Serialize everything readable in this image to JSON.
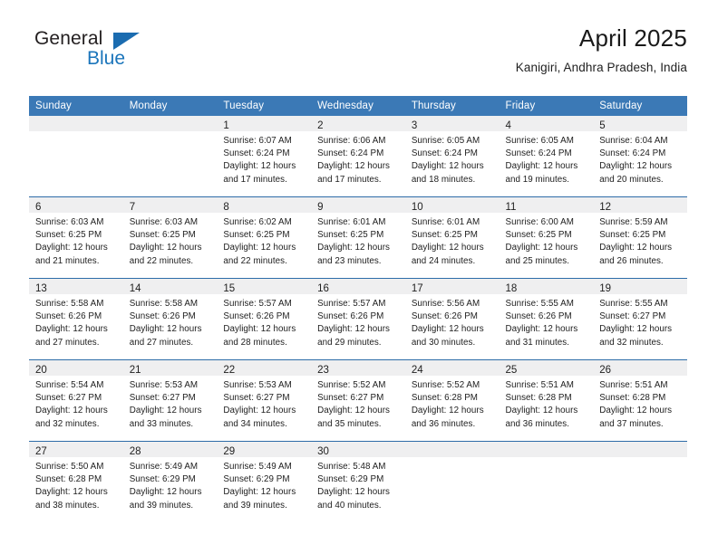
{
  "brand": {
    "name_top": "General",
    "name_bottom": "Blue",
    "color_dark": "#231f20",
    "color_blue": "#1b75bb",
    "triangle_icon": "triangle-icon"
  },
  "header": {
    "title": "April 2025",
    "subtitle": "Kanigiri, Andhra Pradesh, India"
  },
  "theme": {
    "header_blue": "#3b79b6",
    "row_divider": "#2d6ca8",
    "daynum_band": "#efeff0",
    "text": "#1d1d1d"
  },
  "calendar": {
    "weekday_headers": [
      "Sunday",
      "Monday",
      "Tuesday",
      "Wednesday",
      "Thursday",
      "Friday",
      "Saturday"
    ],
    "weeks": [
      [
        {
          "day": "",
          "lines": []
        },
        {
          "day": "",
          "lines": []
        },
        {
          "day": "1",
          "lines": [
            "Sunrise: 6:07 AM",
            "Sunset: 6:24 PM",
            "Daylight: 12 hours",
            "and 17 minutes."
          ]
        },
        {
          "day": "2",
          "lines": [
            "Sunrise: 6:06 AM",
            "Sunset: 6:24 PM",
            "Daylight: 12 hours",
            "and 17 minutes."
          ]
        },
        {
          "day": "3",
          "lines": [
            "Sunrise: 6:05 AM",
            "Sunset: 6:24 PM",
            "Daylight: 12 hours",
            "and 18 minutes."
          ]
        },
        {
          "day": "4",
          "lines": [
            "Sunrise: 6:05 AM",
            "Sunset: 6:24 PM",
            "Daylight: 12 hours",
            "and 19 minutes."
          ]
        },
        {
          "day": "5",
          "lines": [
            "Sunrise: 6:04 AM",
            "Sunset: 6:24 PM",
            "Daylight: 12 hours",
            "and 20 minutes."
          ]
        }
      ],
      [
        {
          "day": "6",
          "lines": [
            "Sunrise: 6:03 AM",
            "Sunset: 6:25 PM",
            "Daylight: 12 hours",
            "and 21 minutes."
          ]
        },
        {
          "day": "7",
          "lines": [
            "Sunrise: 6:03 AM",
            "Sunset: 6:25 PM",
            "Daylight: 12 hours",
            "and 22 minutes."
          ]
        },
        {
          "day": "8",
          "lines": [
            "Sunrise: 6:02 AM",
            "Sunset: 6:25 PM",
            "Daylight: 12 hours",
            "and 22 minutes."
          ]
        },
        {
          "day": "9",
          "lines": [
            "Sunrise: 6:01 AM",
            "Sunset: 6:25 PM",
            "Daylight: 12 hours",
            "and 23 minutes."
          ]
        },
        {
          "day": "10",
          "lines": [
            "Sunrise: 6:01 AM",
            "Sunset: 6:25 PM",
            "Daylight: 12 hours",
            "and 24 minutes."
          ]
        },
        {
          "day": "11",
          "lines": [
            "Sunrise: 6:00 AM",
            "Sunset: 6:25 PM",
            "Daylight: 12 hours",
            "and 25 minutes."
          ]
        },
        {
          "day": "12",
          "lines": [
            "Sunrise: 5:59 AM",
            "Sunset: 6:25 PM",
            "Daylight: 12 hours",
            "and 26 minutes."
          ]
        }
      ],
      [
        {
          "day": "13",
          "lines": [
            "Sunrise: 5:58 AM",
            "Sunset: 6:26 PM",
            "Daylight: 12 hours",
            "and 27 minutes."
          ]
        },
        {
          "day": "14",
          "lines": [
            "Sunrise: 5:58 AM",
            "Sunset: 6:26 PM",
            "Daylight: 12 hours",
            "and 27 minutes."
          ]
        },
        {
          "day": "15",
          "lines": [
            "Sunrise: 5:57 AM",
            "Sunset: 6:26 PM",
            "Daylight: 12 hours",
            "and 28 minutes."
          ]
        },
        {
          "day": "16",
          "lines": [
            "Sunrise: 5:57 AM",
            "Sunset: 6:26 PM",
            "Daylight: 12 hours",
            "and 29 minutes."
          ]
        },
        {
          "day": "17",
          "lines": [
            "Sunrise: 5:56 AM",
            "Sunset: 6:26 PM",
            "Daylight: 12 hours",
            "and 30 minutes."
          ]
        },
        {
          "day": "18",
          "lines": [
            "Sunrise: 5:55 AM",
            "Sunset: 6:26 PM",
            "Daylight: 12 hours",
            "and 31 minutes."
          ]
        },
        {
          "day": "19",
          "lines": [
            "Sunrise: 5:55 AM",
            "Sunset: 6:27 PM",
            "Daylight: 12 hours",
            "and 32 minutes."
          ]
        }
      ],
      [
        {
          "day": "20",
          "lines": [
            "Sunrise: 5:54 AM",
            "Sunset: 6:27 PM",
            "Daylight: 12 hours",
            "and 32 minutes."
          ]
        },
        {
          "day": "21",
          "lines": [
            "Sunrise: 5:53 AM",
            "Sunset: 6:27 PM",
            "Daylight: 12 hours",
            "and 33 minutes."
          ]
        },
        {
          "day": "22",
          "lines": [
            "Sunrise: 5:53 AM",
            "Sunset: 6:27 PM",
            "Daylight: 12 hours",
            "and 34 minutes."
          ]
        },
        {
          "day": "23",
          "lines": [
            "Sunrise: 5:52 AM",
            "Sunset: 6:27 PM",
            "Daylight: 12 hours",
            "and 35 minutes."
          ]
        },
        {
          "day": "24",
          "lines": [
            "Sunrise: 5:52 AM",
            "Sunset: 6:28 PM",
            "Daylight: 12 hours",
            "and 36 minutes."
          ]
        },
        {
          "day": "25",
          "lines": [
            "Sunrise: 5:51 AM",
            "Sunset: 6:28 PM",
            "Daylight: 12 hours",
            "and 36 minutes."
          ]
        },
        {
          "day": "26",
          "lines": [
            "Sunrise: 5:51 AM",
            "Sunset: 6:28 PM",
            "Daylight: 12 hours",
            "and 37 minutes."
          ]
        }
      ],
      [
        {
          "day": "27",
          "lines": [
            "Sunrise: 5:50 AM",
            "Sunset: 6:28 PM",
            "Daylight: 12 hours",
            "and 38 minutes."
          ]
        },
        {
          "day": "28",
          "lines": [
            "Sunrise: 5:49 AM",
            "Sunset: 6:29 PM",
            "Daylight: 12 hours",
            "and 39 minutes."
          ]
        },
        {
          "day": "29",
          "lines": [
            "Sunrise: 5:49 AM",
            "Sunset: 6:29 PM",
            "Daylight: 12 hours",
            "and 39 minutes."
          ]
        },
        {
          "day": "30",
          "lines": [
            "Sunrise: 5:48 AM",
            "Sunset: 6:29 PM",
            "Daylight: 12 hours",
            "and 40 minutes."
          ]
        },
        {
          "day": "",
          "lines": []
        },
        {
          "day": "",
          "lines": []
        },
        {
          "day": "",
          "lines": []
        }
      ]
    ]
  }
}
